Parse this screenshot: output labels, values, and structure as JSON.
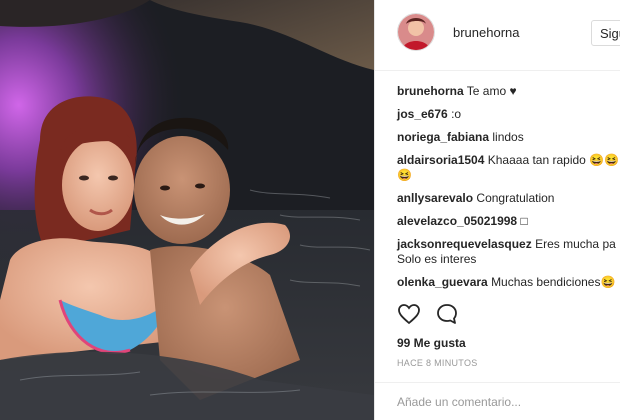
{
  "post": {
    "username": "brunehorna",
    "follow_label": "Sigu",
    "caption_user": "brunehorna",
    "caption_text": "Te amo",
    "caption_heart": "♥"
  },
  "comments": [
    {
      "user": "jos_e676",
      "text": ":o"
    },
    {
      "user": "noriega_fabiana",
      "text": "lindos"
    },
    {
      "user": "aldairsoria1504",
      "text": "Khaaaa tan rapido 😆😆",
      "extra": "😆"
    },
    {
      "user": "anllysarevalo",
      "text": "Congratulation"
    },
    {
      "user": "alevelazco_05021998",
      "text": "□"
    },
    {
      "user": "jacksonrequevelasquez",
      "text": "Eres mucha pa",
      "extra": "Solo es interes"
    },
    {
      "user": "olenka_guevara",
      "text": "Muchas bendiciones😆"
    }
  ],
  "likes": "99 Me gusta",
  "timestamp": "HACE 8 MINUTOS",
  "comment_placeholder": "Añade un comentario...",
  "colors": {
    "text": "#262626",
    "muted": "#999999",
    "border": "#efefef"
  },
  "icons": [
    "heart-icon",
    "comment-icon"
  ]
}
